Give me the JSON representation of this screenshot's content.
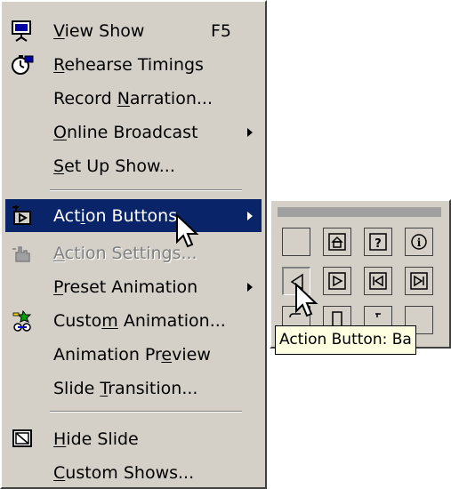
{
  "menu": {
    "items": [
      {
        "pre": "",
        "ul": "V",
        "post": "iew Show",
        "shortcut": "F5",
        "icon": "view-show-icon"
      },
      {
        "pre": "",
        "ul": "R",
        "post": "ehearse Timings",
        "icon": "rehearse-timings-icon"
      },
      {
        "pre": "Record ",
        "ul": "N",
        "post": "arration..."
      },
      {
        "pre": "",
        "ul": "O",
        "post": "nline Broadcast"
      },
      {
        "pre": "",
        "ul": "S",
        "post": "et Up Show..."
      },
      {
        "pre": "Act",
        "ul": "i",
        "post": "on Buttons",
        "icon": "action-buttons-icon"
      },
      {
        "pre": "",
        "ul": "A",
        "post": "ction Settings...",
        "icon": "action-settings-icon"
      },
      {
        "pre": "",
        "ul": "P",
        "post": "reset Animation"
      },
      {
        "pre": "Custo",
        "ul": "m",
        "post": " Animation...",
        "icon": "custom-animation-icon"
      },
      {
        "pre": "Animation Pr",
        "ul": "e",
        "post": "view"
      },
      {
        "pre": "Slide ",
        "ul": "T",
        "post": "ransition..."
      },
      {
        "pre": "",
        "ul": "H",
        "post": "ide Slide",
        "icon": "hide-slide-icon"
      },
      {
        "pre": "",
        "ul": "C",
        "post": "ustom Shows..."
      }
    ]
  },
  "palette": {
    "buttons": [
      "custom",
      "home",
      "help",
      "information",
      "back-previous",
      "forward-next",
      "beginning",
      "end",
      "return",
      "document",
      "sound",
      "movie"
    ]
  },
  "tooltip": "Action Button: Ba",
  "colors": {
    "menu_bg": "#d4d0c8",
    "highlight": "#0a246a",
    "tooltip_bg": "#ffffe1"
  }
}
